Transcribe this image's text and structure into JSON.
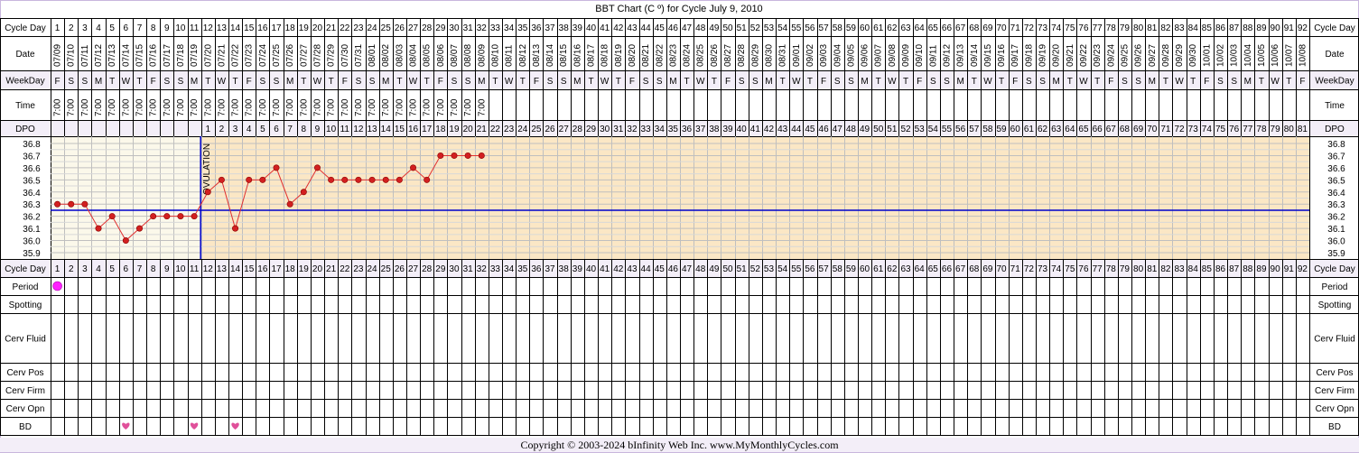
{
  "title": "BBT Chart (C º) for Cycle July 9, 2010",
  "copyright": "Copyright © 2003-2024 bInfinity Web Inc.    www.MyMonthlyCycles.com",
  "row_labels": {
    "cycle_day": "Cycle Day",
    "date": "Date",
    "weekday": "WeekDay",
    "time": "Time",
    "dpo": "DPO",
    "period": "Period",
    "spotting": "Spotting",
    "cerv_fluid": "Cerv Fluid",
    "cerv_pos": "Cerv Pos",
    "cerv_firm": "Cerv Firm",
    "cerv_opn": "Cerv Opn",
    "bd": "BD"
  },
  "ovulation_label": "OVULATION",
  "colors": {
    "pre_ovulation_bg": "#fbf8ea",
    "post_ovulation_bg": "#fbe7c5",
    "header_bg": "#ffffff",
    "alt_row_bg": "#f3eef8",
    "grid": "#bfbfbf",
    "coverline": "#0000cc",
    "temp_line": "#e03030",
    "temp_dot": "#d22020",
    "period_dot": "#ff22ff",
    "bd_heart": "#e0509a"
  },
  "chart_data": {
    "type": "line",
    "title": "BBT Chart (C º) for Cycle July 9, 2010",
    "ylim": [
      35.9,
      36.8
    ],
    "y_ticks": [
      "36.8",
      "36.7",
      "36.6",
      "36.5",
      "36.4",
      "36.3",
      "36.2",
      "36.1",
      "36.0",
      "35.9"
    ],
    "cycle_days": [
      1,
      2,
      3,
      4,
      5,
      6,
      7,
      8,
      9,
      10,
      11,
      12,
      13,
      14,
      15,
      16,
      17,
      18,
      19,
      20,
      21,
      22,
      23,
      24,
      25,
      26,
      27,
      28,
      29,
      30,
      31,
      32,
      33,
      34,
      35,
      36,
      37,
      38,
      39,
      40,
      41,
      42,
      43,
      44,
      45,
      46,
      47,
      48,
      49,
      50,
      51,
      52,
      53,
      54,
      55,
      56,
      57,
      58,
      59,
      60,
      61,
      62,
      63,
      64,
      65,
      66,
      67,
      68,
      69,
      70,
      71,
      72,
      73,
      74,
      75,
      76,
      77,
      78,
      79,
      80,
      81,
      82,
      83,
      84,
      85,
      86,
      87,
      88,
      89,
      90,
      91,
      92
    ],
    "dates": [
      "07/09",
      "07/10",
      "07/11",
      "07/12",
      "07/13",
      "07/14",
      "07/15",
      "07/16",
      "07/17",
      "07/18",
      "07/19",
      "07/20",
      "07/21",
      "07/22",
      "07/23",
      "07/24",
      "07/25",
      "07/26",
      "07/27",
      "07/28",
      "07/29",
      "07/30",
      "07/31",
      "08/01",
      "08/02",
      "08/03",
      "08/04",
      "08/05",
      "08/06",
      "08/07",
      "08/08",
      "08/09",
      "08/10",
      "08/11",
      "08/12",
      "08/13",
      "08/14",
      "08/15",
      "08/16",
      "08/17",
      "08/18",
      "08/19",
      "08/20",
      "08/21",
      "08/22",
      "08/23",
      "08/24",
      "08/25",
      "08/26",
      "08/27",
      "08/28",
      "08/29",
      "08/30",
      "08/31",
      "09/01",
      "09/02",
      "09/03",
      "09/04",
      "09/05",
      "09/06",
      "09/07",
      "09/08",
      "09/09",
      "09/10",
      "09/11",
      "09/12",
      "09/13",
      "09/14",
      "09/15",
      "09/16",
      "09/17",
      "09/18",
      "09/19",
      "09/20",
      "09/21",
      "09/22",
      "09/23",
      "09/24",
      "09/25",
      "09/26",
      "09/27",
      "09/28",
      "09/29",
      "09/30",
      "10/01",
      "10/02",
      "10/03",
      "10/04",
      "10/05",
      "10/06",
      "10/07",
      "10/08"
    ],
    "weekdays": [
      "F",
      "S",
      "S",
      "M",
      "T",
      "W",
      "T",
      "F",
      "S",
      "S",
      "M",
      "T",
      "W",
      "T",
      "F",
      "S",
      "S",
      "M",
      "T",
      "W",
      "T",
      "F",
      "S",
      "S",
      "M",
      "T",
      "W",
      "T",
      "F",
      "S",
      "S",
      "M",
      "T",
      "W",
      "T",
      "F",
      "S",
      "S",
      "M",
      "T",
      "W",
      "T",
      "F",
      "S",
      "S",
      "M",
      "T",
      "W",
      "T",
      "F",
      "S",
      "S",
      "M",
      "T",
      "W",
      "T",
      "F",
      "S",
      "S",
      "M",
      "T",
      "W",
      "T",
      "F",
      "S",
      "S",
      "M",
      "T",
      "W",
      "T",
      "F",
      "S",
      "S",
      "M",
      "T",
      "W",
      "T",
      "F",
      "S",
      "S",
      "M",
      "T",
      "W",
      "T",
      "F",
      "S",
      "S",
      "M",
      "T",
      "W",
      "T",
      "F"
    ],
    "times": [
      "7:00",
      "7:00",
      "7:00",
      "7:00",
      "7:00",
      "7:00",
      "7:00",
      "7:00",
      "7:00",
      "7:00",
      "7:00",
      "7:00",
      "7:00",
      "7:00",
      "7:00",
      "7:00",
      "7:00",
      "7:00",
      "7:00",
      "7:00",
      "7:00",
      "7:00",
      "7:00",
      "7:00",
      "7:00",
      "7:00",
      "7:00",
      "7:00",
      "7:00",
      "7:00",
      "7:00",
      "7:00"
    ],
    "dpo": [
      1,
      2,
      3,
      4,
      5,
      6,
      7,
      8,
      9,
      10,
      11,
      12,
      13,
      14,
      15,
      16,
      17,
      18,
      19,
      20,
      21,
      22,
      23,
      24,
      25,
      26,
      27,
      28,
      29,
      30,
      31,
      32,
      33,
      34,
      35,
      36,
      37,
      38,
      39,
      40,
      41,
      42,
      43,
      44,
      45,
      46,
      47,
      48,
      49,
      50,
      51,
      52,
      53,
      54,
      55,
      56,
      57,
      58,
      59,
      60,
      61,
      62,
      63,
      64,
      65,
      66,
      67,
      68,
      69,
      70,
      71,
      72,
      73,
      74,
      75,
      76,
      77,
      78,
      79,
      80,
      81
    ],
    "dpo_start_day": 12,
    "series": [
      {
        "x": [
          1,
          2,
          3,
          4,
          5,
          6,
          7,
          8,
          9,
          10,
          11,
          12,
          13,
          14,
          15,
          16,
          17,
          18,
          19,
          20,
          21,
          22,
          23,
          24,
          25,
          26,
          27,
          28,
          29,
          30,
          31,
          32
        ],
        "values": [
          36.3,
          36.3,
          36.3,
          36.1,
          36.2,
          36.0,
          36.1,
          36.2,
          36.2,
          36.2,
          36.2,
          36.4,
          36.5,
          36.1,
          36.5,
          36.5,
          36.6,
          36.3,
          36.4,
          36.6,
          36.5,
          36.5,
          36.5,
          36.5,
          36.5,
          36.5,
          36.6,
          36.5,
          36.7,
          36.7,
          36.7,
          36.7
        ]
      }
    ],
    "coverline": 36.25,
    "ovulation_day": 11,
    "period_days": [
      1
    ],
    "spotting_days": [],
    "bd_days": [
      6,
      11,
      14
    ],
    "grid": true
  }
}
